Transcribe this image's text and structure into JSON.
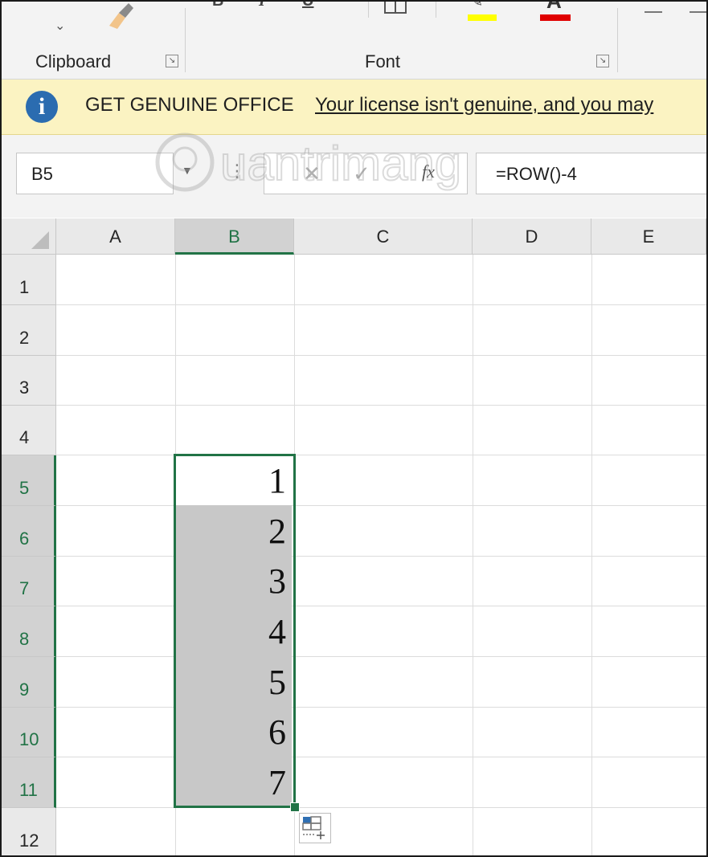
{
  "ribbon": {
    "groups": [
      {
        "label": "Clipboard"
      },
      {
        "label": "Font"
      }
    ],
    "font_buttons": [
      "B",
      "I",
      "U"
    ],
    "highlight_color": "#ffff00",
    "font_color": "#e00000"
  },
  "notice": {
    "title": "GET GENUINE OFFICE",
    "link": "Your license isn't genuine, and you may"
  },
  "formula_bar": {
    "name_box": "B5",
    "fx_label": "fx",
    "formula": "=ROW()-4"
  },
  "sheet": {
    "columns": [
      "A",
      "B",
      "C",
      "D",
      "E"
    ],
    "selected_column": "B",
    "rows": [
      "1",
      "2",
      "3",
      "4",
      "5",
      "6",
      "7",
      "8",
      "9",
      "10",
      "11",
      "12"
    ],
    "selected_rows": [
      "5",
      "6",
      "7",
      "8",
      "9",
      "10",
      "11"
    ],
    "b_values": [
      "1",
      "2",
      "3",
      "4",
      "5",
      "6",
      "7"
    ]
  },
  "colors": {
    "accent": "#217346",
    "ribbon_bg": "#f3f3f3",
    "notice_bg": "#fbf3c2",
    "info_icon": "#2b6cb0"
  },
  "watermark": {
    "text": "Quantrimang"
  }
}
